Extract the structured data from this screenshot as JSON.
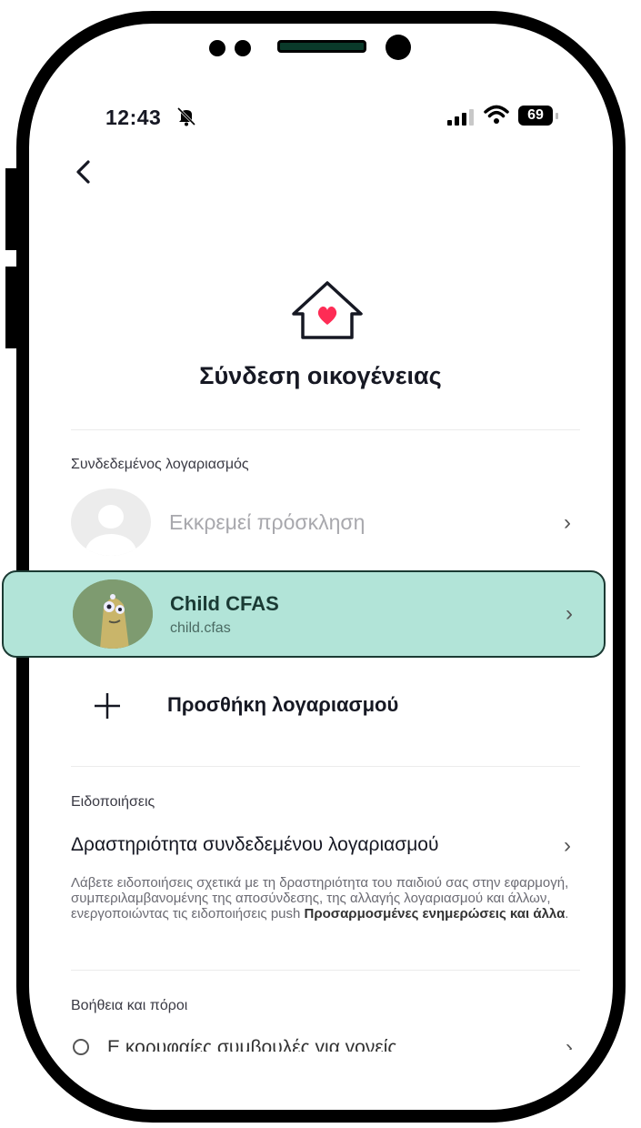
{
  "status_bar": {
    "time": "12:43",
    "battery": "69"
  },
  "header": {
    "title": "Σύνδεση οικογένειας"
  },
  "linked_accounts": {
    "section_label": "Συνδεδεμένος λογαριασμός",
    "pending": {
      "label": "Εκκρεμεί πρόσκληση"
    },
    "child": {
      "name": "Child CFAS",
      "username": "child.cfas"
    },
    "add_label": "Προσθήκη λογαριασμού"
  },
  "notifications": {
    "section_label": "Ειδοποιήσεις",
    "title": "Δραστηριότητα συνδεδεμένου λογαριασμού",
    "description": "Λάβετε ειδοποιήσεις σχετικά με τη δραστηριότητα του παιδιού σας στην εφαρμογή, συμπεριλαμβανομένης της αποσύνδεσης, της αλλαγής λογαριασμού και άλλων, ενεργοποιώντας τις ειδοποιήσεις push ",
    "description_bold": "Προσαρμοσμένες ενημερώσεις και άλλα",
    "description_end": "."
  },
  "help": {
    "section_label": "Βοήθεια και πόροι",
    "first_item": "Ε κορυφαίες συμβουλές για γονείς"
  },
  "colors": {
    "highlight": "#b2e4d8",
    "heart": "#fe2c55"
  }
}
